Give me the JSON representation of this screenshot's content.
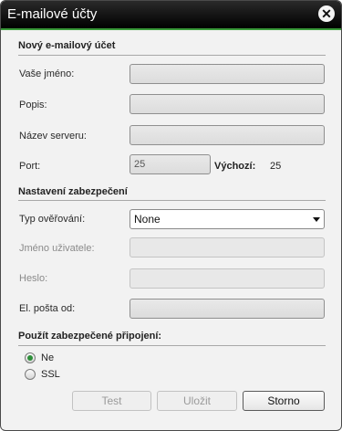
{
  "window": {
    "title": "E-mailové účty",
    "accent": "#3a9a3a"
  },
  "account_section": {
    "heading": "Nový e-mailový účet",
    "name_label": "Vaše jméno:",
    "desc_label": "Popis:",
    "server_label": "Název serveru:",
    "port_label": "Port:",
    "port_value": "25",
    "default_label": "Výchozí:",
    "default_value": "25"
  },
  "security_section": {
    "heading": "Nastavení zabezpečení",
    "auth_label": "Typ ověřování:",
    "auth_value": "None",
    "user_label": "Jméno uživatele:",
    "pass_label": "Heslo:",
    "from_label": "El. pošta od:"
  },
  "secure_conn": {
    "heading": "Použít zabezpečené připojení:",
    "options": [
      "Ne",
      "SSL"
    ],
    "selected": "Ne"
  },
  "buttons": {
    "test": "Test",
    "save": "Uložit",
    "cancel": "Storno"
  }
}
